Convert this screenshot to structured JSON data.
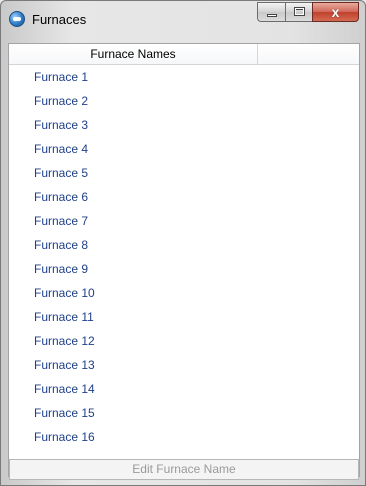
{
  "window": {
    "title": "Furnaces",
    "close_glyph": "x"
  },
  "grid": {
    "header": "Furnace Names",
    "rows": [
      "Furnace 1",
      "Furnace 2",
      "Furnace 3",
      "Furnace 4",
      "Furnace 5",
      "Furnace 6",
      "Furnace 7",
      "Furnace 8",
      "Furnace 9",
      "Furnace 10",
      "Furnace 11",
      "Furnace 12",
      "Furnace 13",
      "Furnace 14",
      "Furnace 15",
      "Furnace 16"
    ]
  },
  "footer": {
    "edit_label": "Edit Furnace Name"
  }
}
